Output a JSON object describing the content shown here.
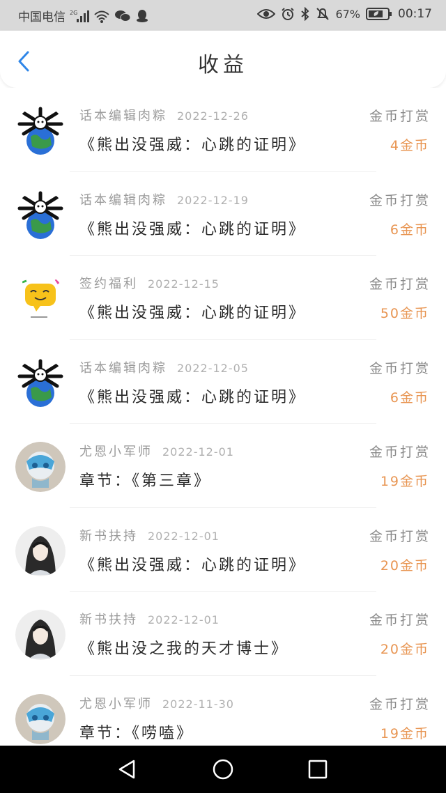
{
  "status_bar": {
    "carrier": "中国电信",
    "network": "2G",
    "battery_percent": "67%",
    "time": "00:17",
    "icons": [
      "signal-icon",
      "wifi-icon",
      "wechat-icon",
      "qq-icon",
      "eye-icon",
      "alarm-icon",
      "bluetooth-icon",
      "mute-icon",
      "battery-icon"
    ]
  },
  "header": {
    "title": "收益",
    "back_icon": "chevron-left-icon"
  },
  "records": [
    {
      "sender": "话本编辑肉粽",
      "date": "2022-12-26",
      "type": "金币打赏",
      "work": "《熊出没强威：心跳的证明》",
      "amount": "4金币",
      "avatar": "bones-globe"
    },
    {
      "sender": "话本编辑肉粽",
      "date": "2022-12-19",
      "type": "金币打赏",
      "work": "《熊出没强威：心跳的证明》",
      "amount": "6金币",
      "avatar": "bones-globe"
    },
    {
      "sender": "签约福利",
      "date": "2022-12-15",
      "type": "金币打赏",
      "work": "《熊出没强威：心跳的证明》",
      "amount": "50金币",
      "avatar": "chat-bubble"
    },
    {
      "sender": "话本编辑肉粽",
      "date": "2022-12-05",
      "type": "金币打赏",
      "work": "《熊出没强威：心跳的证明》",
      "amount": "6金币",
      "avatar": "bones-globe"
    },
    {
      "sender": "尤恩小军师",
      "date": "2022-12-01",
      "type": "金币打赏",
      "work": "章节：《第三章》",
      "amount": "19金币",
      "avatar": "blue-mask"
    },
    {
      "sender": "新书扶持",
      "date": "2022-12-01",
      "type": "金币打赏",
      "work": "《熊出没强威：心跳的证明》",
      "amount": "20金币",
      "avatar": "ink-portrait"
    },
    {
      "sender": "新书扶持",
      "date": "2022-12-01",
      "type": "金币打赏",
      "work": "《熊出没之我的天才博士》",
      "amount": "20金币",
      "avatar": "ink-portrait"
    },
    {
      "sender": "尤恩小军师",
      "date": "2022-11-30",
      "type": "金币打赏",
      "work": "章节：《唠嗑》",
      "amount": "19金币",
      "avatar": "blue-mask"
    }
  ],
  "nav_bar": {
    "icons": [
      "back-triangle-icon",
      "home-circle-icon",
      "recents-square-icon"
    ]
  },
  "colors": {
    "amount": "#e89552",
    "header_back": "#2f86e8",
    "status_bg": "#d9d9d9"
  }
}
